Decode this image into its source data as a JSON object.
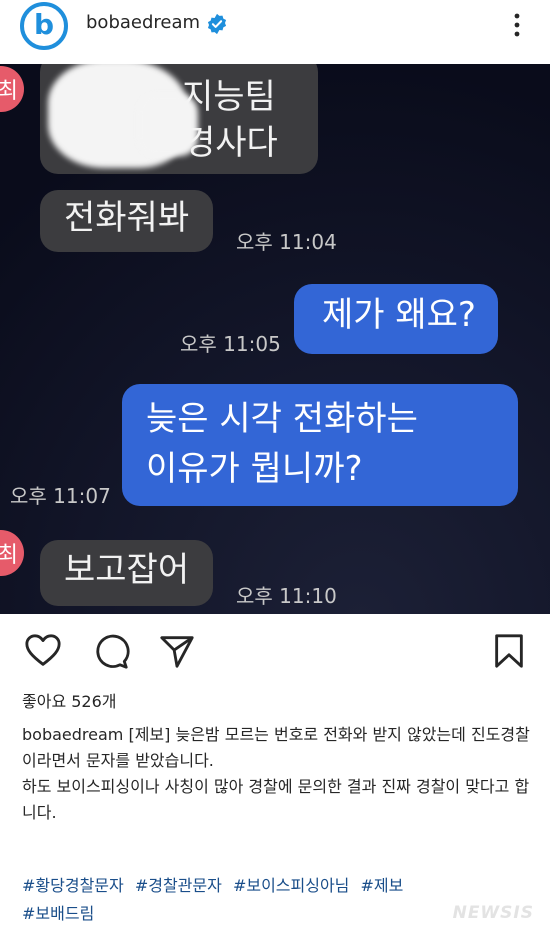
{
  "header": {
    "username": "bobaedream",
    "avatar_letter": "b"
  },
  "chat": {
    "side_avatar_letter": "최",
    "messages": [
      {
        "direction": "incoming",
        "lines": [
          "지능팀",
          "경사다"
        ]
      },
      {
        "direction": "incoming",
        "text": "전화줘봐",
        "time": "오후 11:04"
      },
      {
        "direction": "outgoing",
        "text": "제가 왜요?",
        "time": "오후 11:05"
      },
      {
        "direction": "outgoing",
        "lines": [
          "늦은 시각 전화하는",
          "이유가 뭡니까?"
        ],
        "time": "오후 11:07"
      },
      {
        "direction": "incoming",
        "text": "보고잡어",
        "time": "오후 11:10"
      }
    ]
  },
  "post": {
    "likes": "좋아요 526개",
    "caption_user": "bobaedream",
    "caption_line1": "[제보] 늦은밤 모르는 번호로 전화와 받지 않았는데 진도경찰이라면서 문자를 받았습니다.",
    "caption_line2": "하도 보이스피싱이나 사칭이 많아 경찰에 문의한 결과 진짜 경찰이 맞다고 합니다.",
    "hashtags": [
      "#황당경찰문자",
      "#경찰관문자",
      "#보이스피싱아님",
      "#제보",
      "#보배드림"
    ],
    "watermark": "NEWSIS"
  },
  "colors": {
    "accent": "#1f8fdc",
    "outgoing_bubble": "#3366d6",
    "incoming_bubble": "#3c3c3f",
    "hashtag": "#1a4e8a"
  }
}
